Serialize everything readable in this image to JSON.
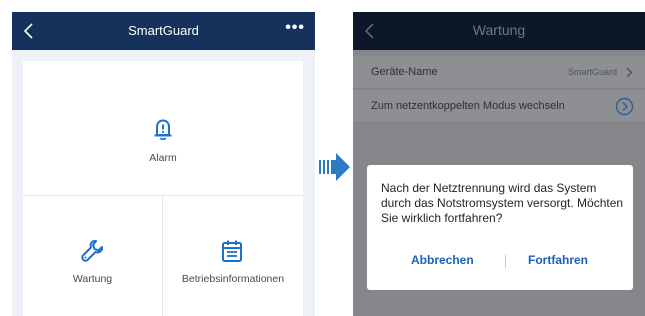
{
  "left_screen": {
    "header": {
      "title": "SmartGuard",
      "back_icon": "chevron-left-icon",
      "more_icon": "more-dots-icon",
      "more_label": "•••"
    },
    "tiles": [
      {
        "label": "Alarm",
        "icon": "bell-alert-icon"
      },
      {
        "label": "Wartung",
        "icon": "wrench-icon"
      },
      {
        "label": "Betriebsinformationen",
        "icon": "calendar-list-icon"
      }
    ],
    "colors": {
      "header_bg": "#14325c",
      "icon_blue": "#1f6fd1",
      "background": "#eef1f6"
    }
  },
  "transition_arrow": {
    "icon": "arrow-right-icon",
    "color": "#2e79c6"
  },
  "right_screen": {
    "header": {
      "title": "Wartung",
      "back_icon": "chevron-left-icon"
    },
    "rows": [
      {
        "label": "Geräte-Name",
        "value": "SmartGuard",
        "icon": "chevron-right-icon"
      },
      {
        "label": "Zum netzentkoppelten Modus wechseln",
        "icon": "circle-chevron-right-icon"
      }
    ],
    "dialog": {
      "message": "Nach der Netztrennung wird das System durch das Notstromsystem versorgt. Möchten Sie wirklich fortfahren?",
      "cancel_label": "Abbrechen",
      "confirm_label": "Fortfahren"
    },
    "colors": {
      "header_bg": "#0c1829",
      "overlay": "#85878b",
      "button_text": "#1c5fbf"
    }
  }
}
